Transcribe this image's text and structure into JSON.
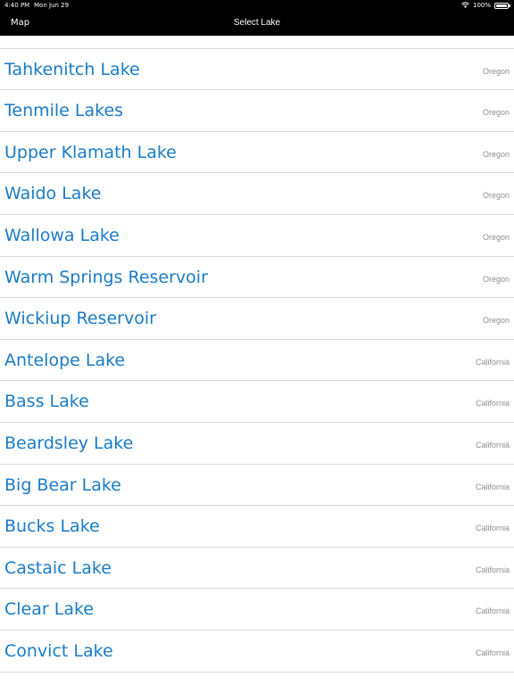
{
  "status_bar": {
    "time": "4:40 PM",
    "date": "Mon Jun 29",
    "battery": "100%",
    "wifi_icon": "wifi-icon",
    "battery_icon": "battery-icon"
  },
  "nav": {
    "back_label": "Map",
    "title": "Select Lake"
  },
  "colors": {
    "nav_background": "#000000",
    "lake_name": "#1a7bc6",
    "state_label": "#8e8e93",
    "separator": "#d9d9de"
  },
  "lakes": [
    {
      "name": "",
      "state": "Oregon"
    },
    {
      "name": "Tahkenitch Lake",
      "state": "Oregon"
    },
    {
      "name": "Tenmile Lakes",
      "state": "Oregon"
    },
    {
      "name": "Upper Klamath Lake",
      "state": "Oregon"
    },
    {
      "name": "Waido Lake",
      "state": "Oregon"
    },
    {
      "name": "Wallowa Lake",
      "state": "Oregon"
    },
    {
      "name": "Warm Springs Reservoir",
      "state": "Oregon"
    },
    {
      "name": "Wickiup Reservoir",
      "state": "Oregon"
    },
    {
      "name": "Antelope Lake",
      "state": "California"
    },
    {
      "name": "Bass Lake",
      "state": "California"
    },
    {
      "name": "Beardsley Lake",
      "state": "California"
    },
    {
      "name": "Big Bear Lake",
      "state": "California"
    },
    {
      "name": "Bucks Lake",
      "state": "California"
    },
    {
      "name": "Castaic Lake",
      "state": "California"
    },
    {
      "name": "Clear Lake",
      "state": "California"
    },
    {
      "name": "Convict Lake",
      "state": "California"
    },
    {
      "name": "",
      "state": ""
    }
  ]
}
